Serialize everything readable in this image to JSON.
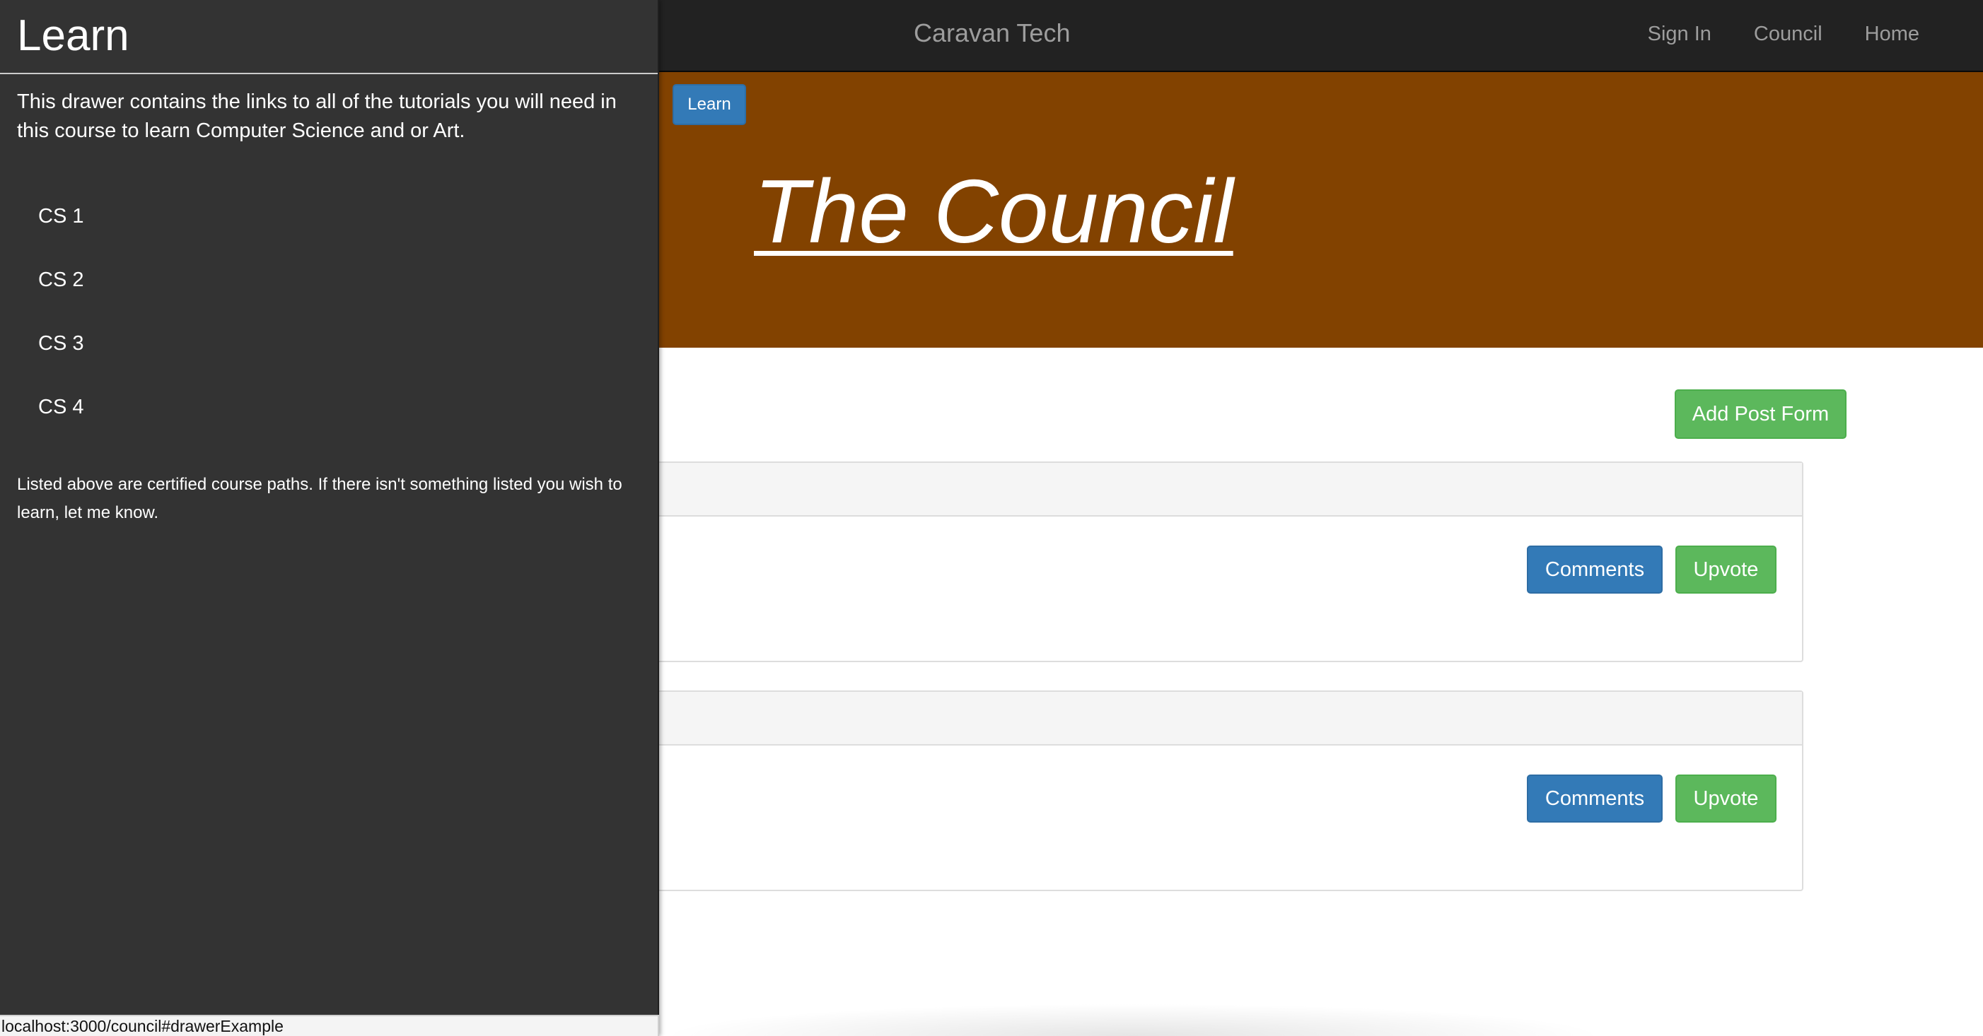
{
  "navbar": {
    "brand": "Caravan Tech",
    "links": [
      "Sign In",
      "Council",
      "Home"
    ]
  },
  "hero": {
    "learn_button": "Learn",
    "title": "The Council"
  },
  "main": {
    "add_post_button": "Add Post Form",
    "posts": [
      {
        "comments_label": "Comments",
        "upvote_label": "Upvote"
      },
      {
        "comments_label": "Comments",
        "upvote_label": "Upvote"
      }
    ]
  },
  "drawer": {
    "title": "Learn",
    "intro": "This drawer contains the links to all of the tutorials you will need in this course to learn Computer Science and or Art.",
    "courses": [
      "CS 1",
      "CS 2",
      "CS 3",
      "CS 4"
    ],
    "footer": "Listed above are certified course paths. If there isn't something listed you wish to learn, let me know."
  },
  "status_bar": {
    "url": "localhost:3000/council#drawerExample"
  },
  "colors": {
    "navbar": "#222222",
    "hero": "#824200",
    "drawer": "#333333",
    "primary": "#337ab7",
    "success": "#5cb85c"
  }
}
